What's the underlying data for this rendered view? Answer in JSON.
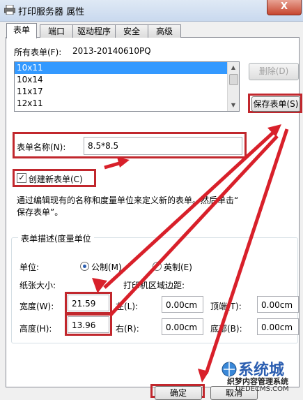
{
  "window": {
    "title": "打印服务器 属性",
    "close_label": "X"
  },
  "tabs": [
    {
      "label": "表单",
      "active": true
    },
    {
      "label": "端口",
      "active": false
    },
    {
      "label": "驱动程序",
      "active": false
    },
    {
      "label": "安全",
      "active": false
    },
    {
      "label": "高级",
      "active": false
    }
  ],
  "forms_list": {
    "label": "所有表单(F):",
    "server_name": "2013-20140610PQ",
    "items": [
      "10x11",
      "10x14",
      "11x17",
      "12x11"
    ],
    "selected_index": 0
  },
  "buttons": {
    "delete": "删除(D)",
    "save_form": "保存表单(S)",
    "ok": "确定",
    "cancel": "取消"
  },
  "form_name": {
    "label": "表单名称(N):",
    "value": "8.5*8.5"
  },
  "create_new": {
    "label": "创建新表单(C)",
    "checked": true
  },
  "description_text": {
    "line1": "通过编辑现有的名称和度量单位来定义新的表单。然后单击“",
    "line2": "保存表单”。"
  },
  "group": {
    "title": "表单描述(度量单位",
    "units_label": "单位:",
    "metric_label": "公制(M)",
    "imperial_label": "英制(E)",
    "metric_selected": true,
    "paper_size_label": "纸张大小:",
    "margins_label": "打印机区域边距:",
    "width_label": "宽度(W):",
    "width_value": "21.59",
    "height_label": "高度(H):",
    "height_value": "13.96",
    "left_label": "左(L):",
    "left_value": "0.00cm",
    "right_label": "右(R):",
    "right_value": "0.00cm",
    "top_label": "顶端(T):",
    "top_value": "0.00cm",
    "bottom_label": "底部(B):",
    "bottom_value": "0.00cm"
  },
  "watermark": {
    "logo_text": "系统城",
    "line1": "织梦内容管理系统",
    "line2": "DEDECMS.COM"
  },
  "colors": {
    "annotation_red": "#c1272d",
    "selection_blue": "#3399ff"
  }
}
